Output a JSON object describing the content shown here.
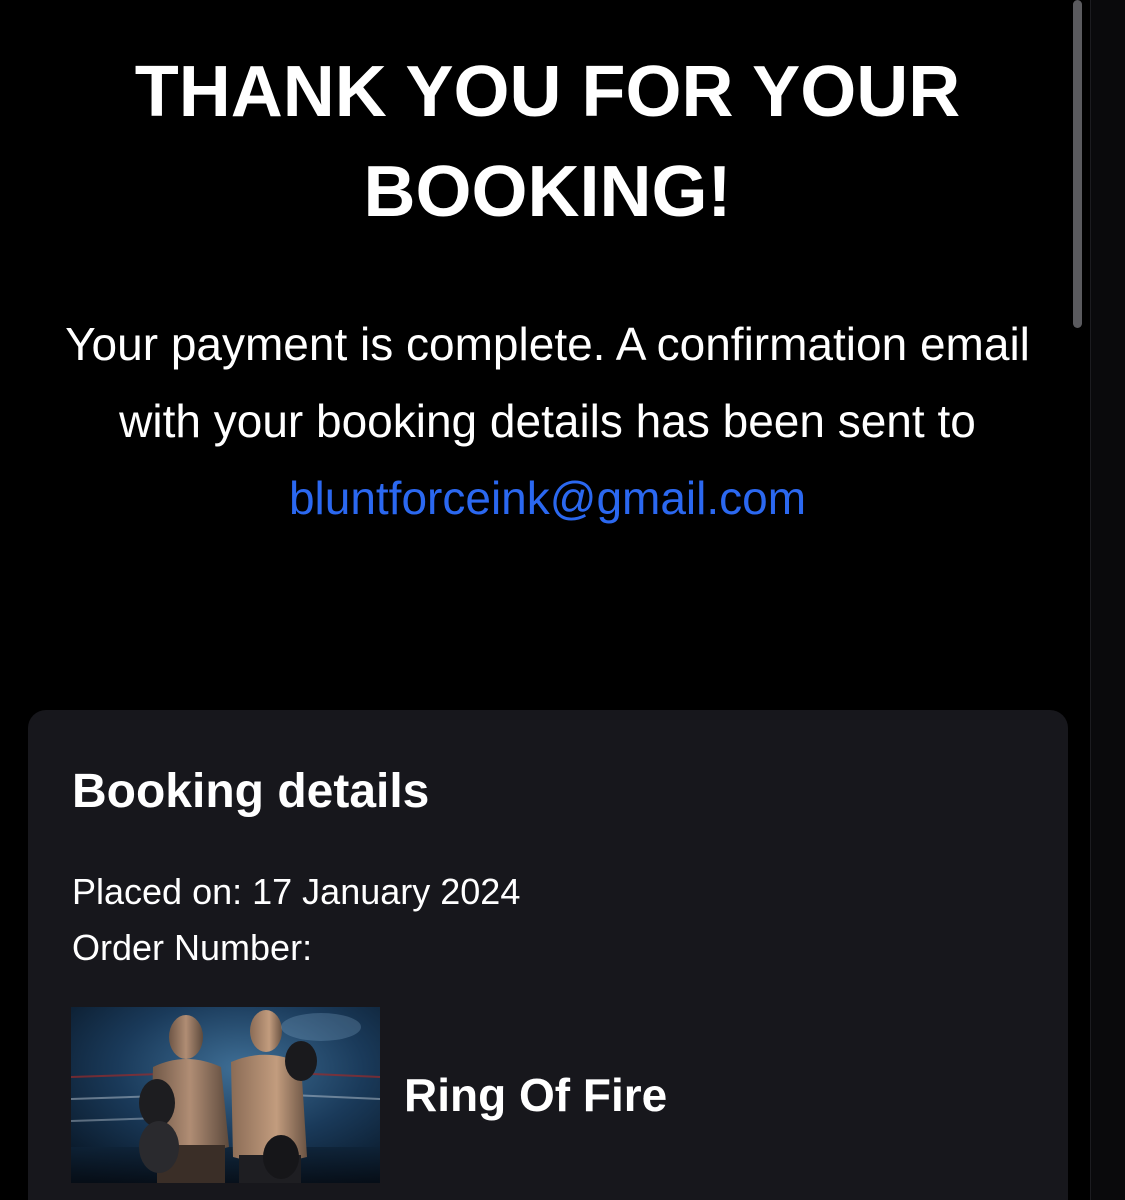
{
  "confirmation": {
    "heading_line1": "THANK YOU FOR YOUR",
    "heading_line2": "BOOKING!",
    "message_prefix": "Your payment is complete. A confirmation email with your booking details has been sent to",
    "email": "bluntforceink@gmail.com"
  },
  "booking": {
    "title": "Booking details",
    "placed_label": "Placed on:",
    "placed_date": "17 January 2024",
    "order_label": "Order Number:",
    "order_value": "",
    "event": {
      "name": "Ring Of Fire",
      "image_icon": "boxers-promo-image"
    }
  },
  "colors": {
    "background": "#000000",
    "card": "#17171c",
    "link": "#2b68f0",
    "text": "#ffffff"
  }
}
